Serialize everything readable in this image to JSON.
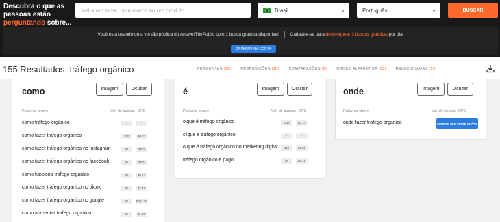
{
  "header": {
    "tagline_1": "Descubra o que as pessoas estão",
    "tagline_highlight": "perguntando",
    "tagline_2": "sobre...",
    "search_placeholder": "Insira um tema, uma marca ou um produto...",
    "country": "Brasil",
    "language": "Português",
    "search_button": "BUSCAR"
  },
  "banner": {
    "text_1": "Você está usando uma versão pública do AnswerThePublic com 1 busca gratuita disponível",
    "text_2": "Cadastre-se para",
    "text_highlight": "desbloquear 3 buscas gratuitas",
    "text_3": "por dia.",
    "button": "CRIAR MINHA CONTA"
  },
  "results": {
    "title": "155 Resultados: tráfego orgânico",
    "tabs": [
      {
        "label": "PERGUNTAS",
        "count": "(32)"
      },
      {
        "label": "PREPOSIÇÕES",
        "count": "(18)"
      },
      {
        "label": "COMPARAÇÕES",
        "count": "(9)"
      },
      {
        "label": "ORDEM ALFABÉTICA",
        "count": "(83)"
      },
      {
        "label": "RELACIONADAS",
        "count": "(15)"
      }
    ],
    "download_icon": "download-icon"
  },
  "columns": {
    "keyword": "Palavras-chave",
    "volume": "Vol. de buscas",
    "cpc": "CPC"
  },
  "buttons": {
    "image": "Imagem",
    "hide": "Ocultar"
  },
  "cards": [
    {
      "title": "como",
      "rows": [
        {
          "kw": "como tráfego orgânico",
          "vol": "-",
          "cpc": "-"
        },
        {
          "kw": "como fazer trafego organico",
          "vol": "260",
          "cpc": "$0.42"
        },
        {
          "kw": "como fazer tráfego orgânico no instagram",
          "vol": "90",
          "cpc": "$0.3"
        },
        {
          "kw": "como fazer tráfego orgânico no facebook",
          "vol": "90",
          "cpc": "$0.5"
        },
        {
          "kw": "como funciona trafego organico",
          "vol": "30",
          "cpc": "$0.13"
        },
        {
          "kw": "como fazer trafego organico no tiktok",
          "vol": "30",
          "cpc": "$7.45"
        },
        {
          "kw": "como fazer trafego organico no google",
          "vol": "30",
          "cpc": "$107.76"
        },
        {
          "kw": "como aumentar trafego organico",
          "vol": "10",
          "cpc": "$1.69"
        }
      ]
    },
    {
      "title": "é",
      "rows": [
        {
          "kw": "o'que é tráfego orgânico",
          "vol": "1.3K",
          "cpc": "$0.14"
        },
        {
          "kw": "clique e tráfego orgânico",
          "vol": "-",
          "cpc": "-"
        },
        {
          "kw": "o que é tráfego orgânico no marketing digital",
          "vol": "110",
          "cpc": "$2.59"
        },
        {
          "kw": "tráfego orgânico é pago",
          "vol": "20",
          "cpc": "$0.46"
        }
      ]
    },
    {
      "title": "onde",
      "rows": [
        {
          "kw": "onde fazer trafego organico"
        }
      ],
      "trial_button": "COMECE SEU TESTE GRÁTIS"
    }
  ]
}
